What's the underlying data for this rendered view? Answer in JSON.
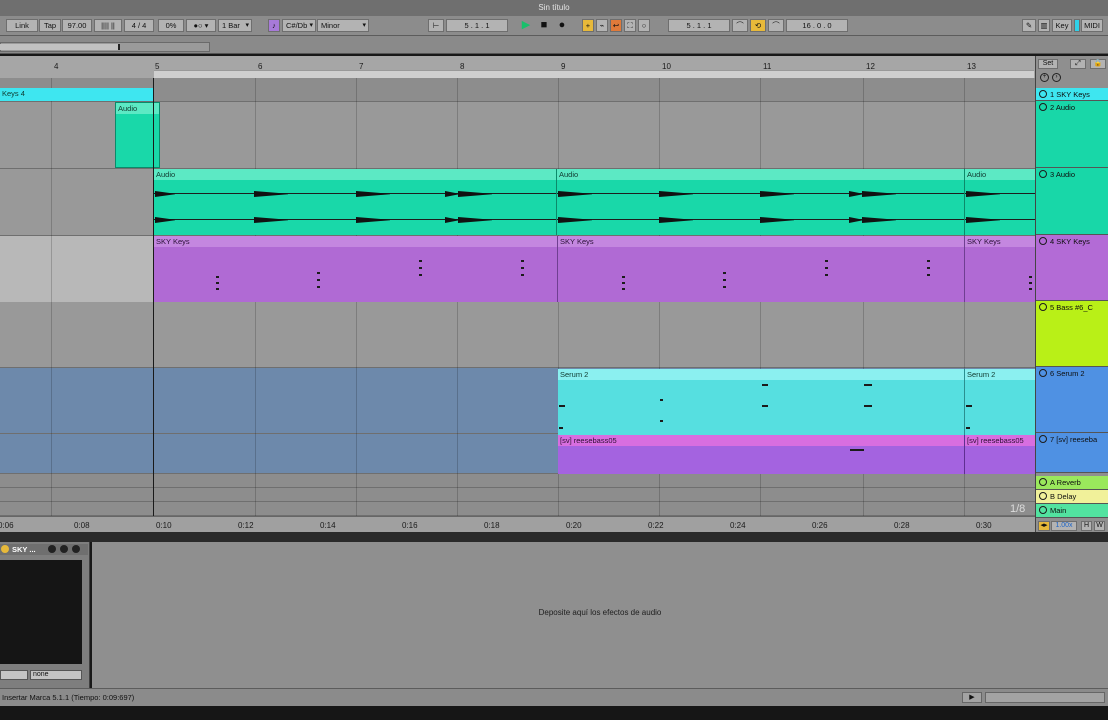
{
  "window": {
    "title": "Sin título"
  },
  "control_bar": {
    "link": "Link",
    "tap": "Tap",
    "tempo": "97.00",
    "signature": "4 / 4",
    "groove": "0%",
    "quantize": "1 Bar",
    "key": "C#/Db",
    "scale": "Minor",
    "position": "5 . 1 . 1",
    "loop_start": "5 . 1 . 1",
    "loop_length": "16 . 0 . 0",
    "key_map": "Key",
    "midi_map": "MIDI"
  },
  "ruler": {
    "bars": [
      "4",
      "5",
      "6",
      "7",
      "8",
      "9",
      "10",
      "11",
      "12",
      "13"
    ],
    "set_button": "Set"
  },
  "time_ruler": {
    "times": [
      "0:06",
      "0:08",
      "0:10",
      "0:12",
      "0:14",
      "0:16",
      "0:18",
      "0:20",
      "0:22",
      "0:24",
      "0:26",
      "0:28",
      "0:30"
    ],
    "grid": "1/8"
  },
  "tracks": [
    {
      "id": 1,
      "name": "1 SKY Keys",
      "color": "#3ee6f0"
    },
    {
      "id": 2,
      "name": "2 Audio",
      "color": "#18d7a8"
    },
    {
      "id": 3,
      "name": "3 Audio",
      "color": "#18d7a8"
    },
    {
      "id": 4,
      "name": "4 SKY Keys",
      "color": "#b36bd6"
    },
    {
      "id": 5,
      "name": "5 Bass #6_C",
      "color": "#b9f017"
    },
    {
      "id": 6,
      "name": "6 Serum 2",
      "color": "#4f91e3"
    },
    {
      "id": 7,
      "name": "7 [sv] reeseba",
      "color": "#9c5ce3"
    },
    {
      "id": "A",
      "name": "A Reverb",
      "color": "#9ae85c"
    },
    {
      "id": "B",
      "name": "B Delay",
      "color": "#f1f19a"
    },
    {
      "id": "M",
      "name": "Main",
      "color": "#52e3a0"
    }
  ],
  "clips": {
    "keys4": "Keys 4",
    "audio_small": "Audio",
    "audio_a": "Audio",
    "audio_b": "Audio",
    "audio_c": "Audio",
    "sky_a": "SKY Keys",
    "sky_b": "SKY Keys",
    "sky_c": "SKY Keys",
    "serum_a": "Serum 2",
    "serum_b": "Serum 2",
    "reese_a": "[sv] reesebass05",
    "reese_b": "[sv] reesebass05"
  },
  "zoom": "1.00x",
  "device": {
    "name": "SKY ...",
    "select_right": "none"
  },
  "fx_area": {
    "drop_hint": "Deposite aquí los efectos de audio"
  },
  "status": {
    "message": "Insertar Marca 5.1.1 (Tiempo: 0:09:697)"
  }
}
